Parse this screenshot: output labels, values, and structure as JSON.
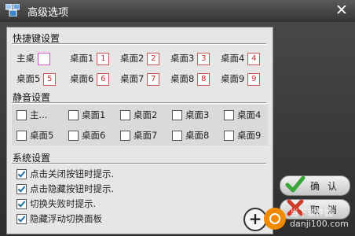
{
  "window": {
    "title": "高级选项",
    "close_glyph": "✕"
  },
  "hotkeys": {
    "title": "快捷键设置",
    "items": [
      {
        "label": "主桌",
        "key": ""
      },
      {
        "label": "桌面1",
        "key": "1"
      },
      {
        "label": "桌面2",
        "key": "2"
      },
      {
        "label": "桌面3",
        "key": "3"
      },
      {
        "label": "桌面4",
        "key": "4"
      },
      {
        "label": "桌面5",
        "key": "5"
      },
      {
        "label": "桌面6",
        "key": "6"
      },
      {
        "label": "桌面7",
        "key": "7"
      },
      {
        "label": "桌面8",
        "key": "8"
      },
      {
        "label": "桌面9",
        "key": "9"
      }
    ]
  },
  "mute": {
    "title": "静音设置",
    "items": [
      {
        "label": "主...",
        "checked": false
      },
      {
        "label": "桌面1",
        "checked": false
      },
      {
        "label": "桌面2",
        "checked": false
      },
      {
        "label": "桌面3",
        "checked": false
      },
      {
        "label": "桌面4",
        "checked": false
      },
      {
        "label": "桌面5",
        "checked": false
      },
      {
        "label": "桌面6",
        "checked": false
      },
      {
        "label": "桌面7",
        "checked": false
      },
      {
        "label": "桌面8",
        "checked": false
      },
      {
        "label": "桌面9",
        "checked": false
      }
    ]
  },
  "system": {
    "title": "系统设置",
    "options": [
      {
        "label": "点击关闭按钮时提示.",
        "checked": true
      },
      {
        "label": "点击隐藏按钮时提示.",
        "checked": true
      },
      {
        "label": "切换失败时提示.",
        "checked": true
      },
      {
        "label": "隐藏浮动切换面板",
        "checked": true
      }
    ]
  },
  "buttons": {
    "confirm": "确认",
    "cancel": "取消"
  },
  "watermark": {
    "site": "当下软件园",
    "url": "danji100.com"
  },
  "colors": {
    "hotkey_border": "#c85a5a",
    "check": "#1d6fa5",
    "confirm_icon": "#3aa63a",
    "cancel_icon": "#cc3a2a"
  }
}
